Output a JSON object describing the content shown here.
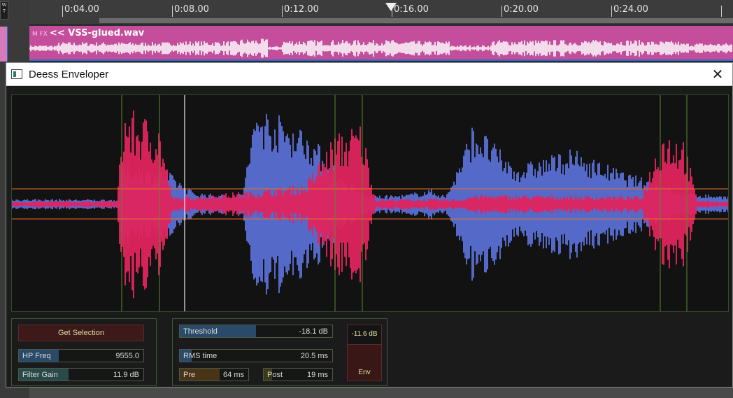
{
  "daw": {
    "left_button": "W\nT",
    "ruler_ticks": [
      "0:04.00",
      "0:08.00",
      "0:12.00",
      "0:16.00",
      "0:20.00",
      "0:24.00"
    ],
    "clip": {
      "prefix": "M FX",
      "name": "<< VSS-glued.wav"
    }
  },
  "dialog": {
    "title": "Deess Enveloper",
    "close_glyph": "✕"
  },
  "controls": {
    "get_selection": "Get Selection",
    "hp_freq": {
      "label": "HP Freq",
      "value": "9555.0",
      "level": 0.32
    },
    "filter_gain": {
      "label": "Filter Gain",
      "value": "11.9 dB",
      "level": 0.4
    },
    "threshold": {
      "label": "Threshold",
      "value": "-18.1 dB",
      "level": 0.5
    },
    "rms_time": {
      "label": "RMS time",
      "value": "20.5 ms",
      "level": 0.08
    },
    "pre": {
      "label": "Pre",
      "value": "64 ms",
      "level": 0.58
    },
    "post": {
      "label": "Post",
      "value": "19 ms",
      "level": 0.12
    },
    "env_meter": {
      "readout": "-11.6 dB",
      "label": "Env"
    }
  },
  "colors": {
    "wave_blue": "#5569c9",
    "wave_pink": "#e0245e",
    "threshold_line": "#e8702a",
    "marker_green": "#5a8a2e",
    "clip_pink": "#c44e9c"
  }
}
